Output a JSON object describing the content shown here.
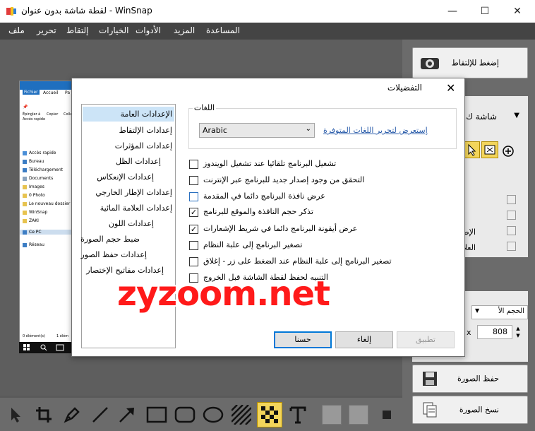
{
  "window": {
    "title": "لقطة شاشة بدون عنوان - WinSnap",
    "minimize": "—",
    "maximize": "☐",
    "close": "✕"
  },
  "menu": [
    "ملف",
    "تحرير",
    "إلتقاط",
    "الخيارات",
    "الأدوات",
    "المزيد",
    "المساعدة"
  ],
  "right_panel": {
    "capture_button": "إضغط للإلتقاط",
    "screen_label": "شاشة ك",
    "label_frame": "الإطا",
    "label_watermark": "العلا",
    "size_select": "الحجم الأ",
    "size_x": "x",
    "size_value": "808",
    "save_button": "حفظ الصورة",
    "copy_button": "نسخ الصورة"
  },
  "explorer": {
    "tabs": [
      "Fichier",
      "Accueil",
      "Pa"
    ],
    "ribbon_items": [
      "Épingler à",
      "Accès rapide",
      "Copier",
      "Colle"
    ],
    "nav": [
      "Accès rapide",
      "Bureau",
      "Téléchargement",
      "Documents",
      "Images",
      "0 Photo",
      "Le nouveau dossier",
      "WinSnap",
      "ZAKI",
      "Ce PC",
      "Réseau"
    ],
    "status": [
      "0 élément(s)",
      "1 élém"
    ]
  },
  "dialog": {
    "title": "التفضيلات",
    "close": "✕",
    "nav": [
      {
        "label": "الإعدادات العامة",
        "selected": true,
        "sub": false
      },
      {
        "label": "إعدادات الإلتقاط",
        "selected": false,
        "sub": false
      },
      {
        "label": "إعدادات المؤثرات",
        "selected": false,
        "sub": false
      },
      {
        "label": "إعدادات الظل",
        "selected": false,
        "sub": true
      },
      {
        "label": "إعدادات الإنعكاس",
        "selected": false,
        "sub": true
      },
      {
        "label": "إعدادات الإطار الخارجي",
        "selected": false,
        "sub": true
      },
      {
        "label": "إعدادات العلامة المائية",
        "selected": false,
        "sub": true
      },
      {
        "label": "إعدادات اللون",
        "selected": false,
        "sub": true
      },
      {
        "label": "ضبط حجم الصورة",
        "selected": false,
        "sub": false
      },
      {
        "label": "إعدادات حفظ الصور",
        "selected": false,
        "sub": false
      },
      {
        "label": "إعدادات مفاتيح الإختصار",
        "selected": false,
        "sub": false
      }
    ],
    "languages_legend": "اللغات",
    "language_value": "Arabic",
    "language_link": "إستعرض لتحرير اللغات المتوفرة",
    "options": [
      {
        "label": "تشغيل البرنامج تلقائيا عند تشغيل الويندوز",
        "checked": false
      },
      {
        "label": "التحقق من وجود إصدار جديد للبرنامج عبر الإنترنت",
        "checked": false
      },
      {
        "label": "عرض نافذة البرنامج دائما في المقدمة",
        "checked": false
      },
      {
        "label": "تذكر حجم النافذة والموقع للبرنامج",
        "checked": true
      },
      {
        "label": "عرض أيقونة البرنامج دائما في شريط الإشعارات",
        "checked": true
      },
      {
        "label": "تصغير البرنامج إلى علبة النظام",
        "checked": false
      },
      {
        "label": "تصغير البرنامج إلى علبة النظام عند الضغط على زر - إغلاق",
        "checked": false
      },
      {
        "label": "التنبيه لحفظ لقطة الشاشة قبل الخروج",
        "checked": false
      }
    ],
    "ok": "حسنا",
    "cancel": "إلغاء",
    "apply": "تطبيق"
  },
  "watermark_text": "zyzoom.net",
  "check_mark": "✓",
  "colors": {
    "accent": "#0078d7",
    "watermark": "#ff1a1a",
    "selection": "#cce4f7",
    "active_tool": "#f3d55b"
  }
}
